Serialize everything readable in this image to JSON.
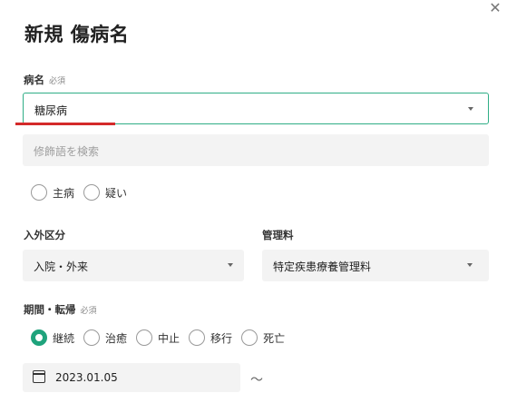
{
  "dialog": {
    "close_glyph": "✕",
    "title": "新規 傷病名"
  },
  "disease": {
    "label": "病名",
    "required": "必須",
    "value": "糖尿病"
  },
  "modifier": {
    "placeholder": "修飾語を検索"
  },
  "disease_type": {
    "options": [
      "主病",
      "疑い"
    ]
  },
  "inout": {
    "label": "入外区分",
    "value": "入院・外来"
  },
  "management": {
    "label": "管理料",
    "value": "特定疾患療養管理料"
  },
  "period": {
    "label": "期間・転帰",
    "required": "必須",
    "options": [
      "継続",
      "治癒",
      "中止",
      "移行",
      "死亡"
    ],
    "selected": "継続"
  },
  "date": {
    "start": "2023.01.05",
    "separator": "～"
  },
  "colors": {
    "accent": "#1fa37c",
    "focus_border": "#2fae86",
    "underline": "#d42a2a"
  }
}
